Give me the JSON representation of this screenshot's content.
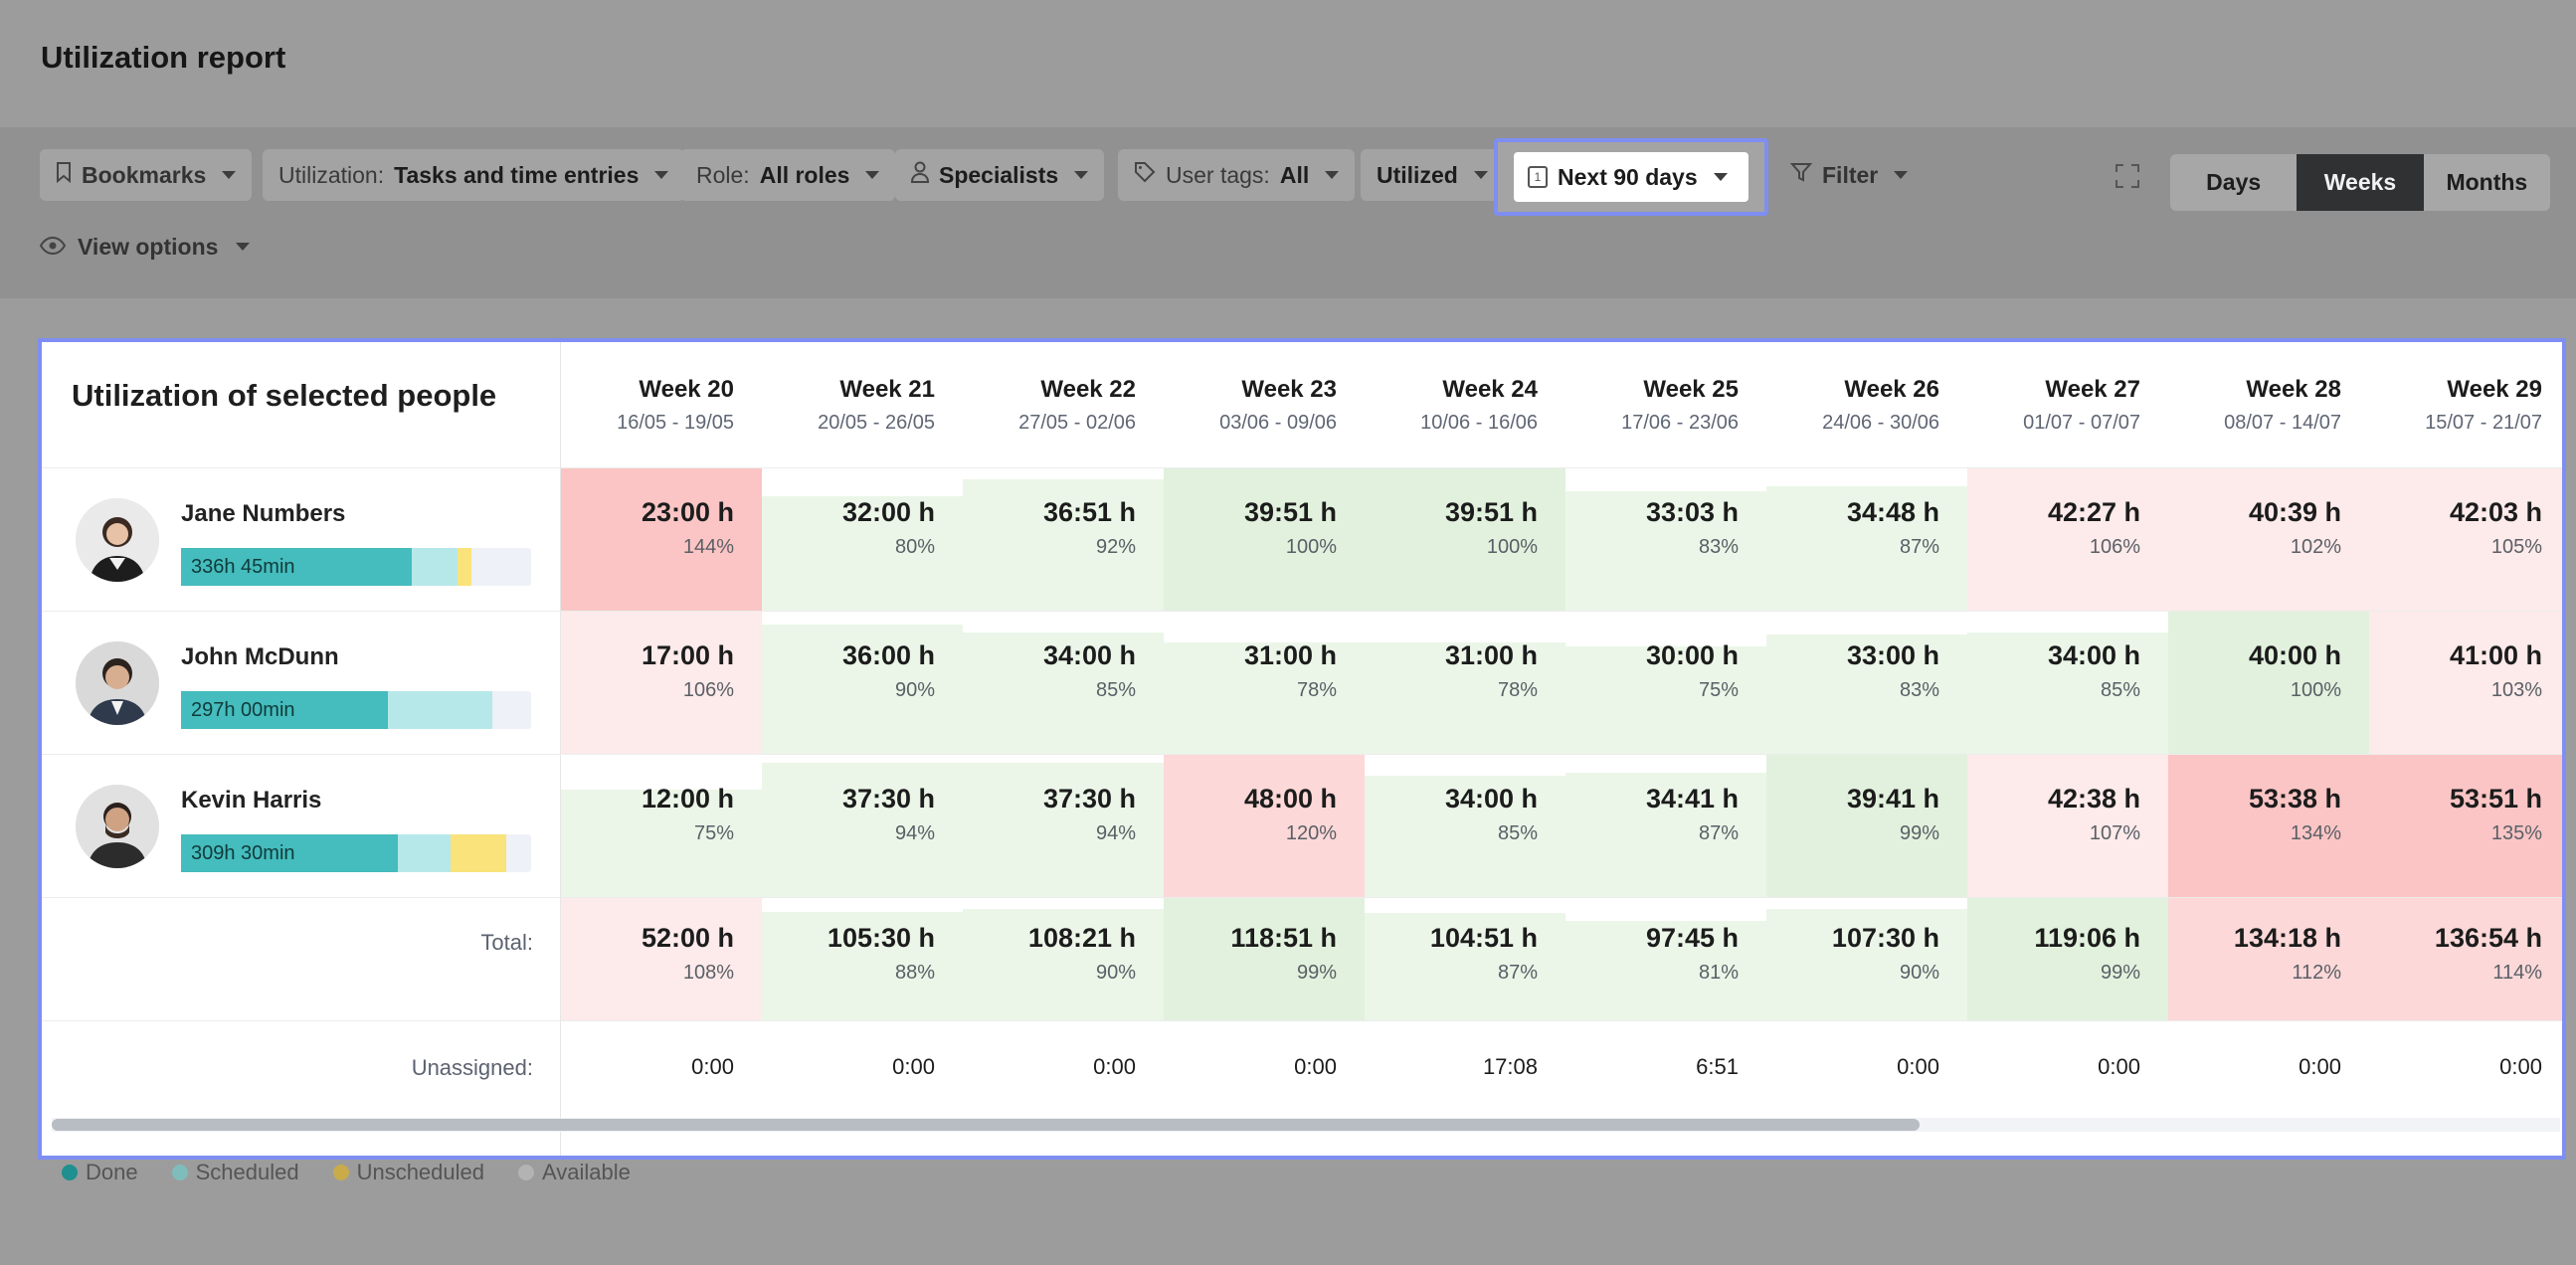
{
  "page": {
    "title": "Utilization report"
  },
  "toolbar": {
    "bookmarks": "Bookmarks",
    "utilization_label": "Utilization:",
    "utilization_value": "Tasks and time entries",
    "role_label": "Role:",
    "role_value": "All roles",
    "specialists": "Specialists",
    "user_tags_label": "User tags:",
    "user_tags_value": "All",
    "utilized": "Utilized",
    "date_range": "Next 90 days",
    "date_icon_num": "1",
    "filter": "Filter",
    "view_options": "View options",
    "periods": [
      "Days",
      "Weeks",
      "Months"
    ],
    "active_period": "Weeks"
  },
  "panel": {
    "title": "Utilization of selected people",
    "total_label": "Total:",
    "unassigned_label": "Unassigned:"
  },
  "weeks": [
    {
      "label": "Week 20",
      "dates": "16/05 - 19/05"
    },
    {
      "label": "Week 21",
      "dates": "20/05 - 26/05"
    },
    {
      "label": "Week 22",
      "dates": "27/05 - 02/06"
    },
    {
      "label": "Week 23",
      "dates": "03/06 - 09/06"
    },
    {
      "label": "Week 24",
      "dates": "10/06 - 16/06"
    },
    {
      "label": "Week 25",
      "dates": "17/06 - 23/06"
    },
    {
      "label": "Week 26",
      "dates": "24/06 - 30/06"
    },
    {
      "label": "Week 27",
      "dates": "01/07 - 07/07"
    },
    {
      "label": "Week 28",
      "dates": "08/07 - 14/07"
    },
    {
      "label": "Week 29",
      "dates": "15/07 - 21/07"
    }
  ],
  "people": [
    {
      "name": "Jane Numbers",
      "total": "336h 45min",
      "bar": {
        "done": 0.66,
        "scheduled": 0.13,
        "unscheduled": 0.04
      },
      "cells": [
        {
          "hours": "23:00 h",
          "pct": "144%",
          "util": 1.44
        },
        {
          "hours": "32:00 h",
          "pct": "80%",
          "util": 0.8
        },
        {
          "hours": "36:51 h",
          "pct": "92%",
          "util": 0.92
        },
        {
          "hours": "39:51 h",
          "pct": "100%",
          "util": 1.0
        },
        {
          "hours": "39:51 h",
          "pct": "100%",
          "util": 1.0
        },
        {
          "hours": "33:03 h",
          "pct": "83%",
          "util": 0.83
        },
        {
          "hours": "34:48 h",
          "pct": "87%",
          "util": 0.87
        },
        {
          "hours": "42:27 h",
          "pct": "106%",
          "util": 1.06
        },
        {
          "hours": "40:39 h",
          "pct": "102%",
          "util": 1.02
        },
        {
          "hours": "42:03 h",
          "pct": "105%",
          "util": 1.05
        }
      ]
    },
    {
      "name": "John McDunn",
      "total": "297h 00min",
      "bar": {
        "done": 0.59,
        "scheduled": 0.3,
        "unscheduled": 0
      },
      "cells": [
        {
          "hours": "17:00 h",
          "pct": "106%",
          "util": 1.06
        },
        {
          "hours": "36:00 h",
          "pct": "90%",
          "util": 0.9
        },
        {
          "hours": "34:00 h",
          "pct": "85%",
          "util": 0.85
        },
        {
          "hours": "31:00 h",
          "pct": "78%",
          "util": 0.78
        },
        {
          "hours": "31:00 h",
          "pct": "78%",
          "util": 0.78
        },
        {
          "hours": "30:00 h",
          "pct": "75%",
          "util": 0.75
        },
        {
          "hours": "33:00 h",
          "pct": "83%",
          "util": 0.83
        },
        {
          "hours": "34:00 h",
          "pct": "85%",
          "util": 0.85
        },
        {
          "hours": "40:00 h",
          "pct": "100%",
          "util": 1.0
        },
        {
          "hours": "41:00 h",
          "pct": "103%",
          "util": 1.03
        }
      ]
    },
    {
      "name": "Kevin Harris",
      "total": "309h 30min",
      "bar": {
        "done": 0.62,
        "scheduled": 0.15,
        "unscheduled": 0.16
      },
      "cells": [
        {
          "hours": "12:00 h",
          "pct": "75%",
          "util": 0.75
        },
        {
          "hours": "37:30 h",
          "pct": "94%",
          "util": 0.94
        },
        {
          "hours": "37:30 h",
          "pct": "94%",
          "util": 0.94
        },
        {
          "hours": "48:00 h",
          "pct": "120%",
          "util": 1.2
        },
        {
          "hours": "34:00 h",
          "pct": "85%",
          "util": 0.85
        },
        {
          "hours": "34:41 h",
          "pct": "87%",
          "util": 0.87
        },
        {
          "hours": "39:41 h",
          "pct": "99%",
          "util": 0.99
        },
        {
          "hours": "42:38 h",
          "pct": "107%",
          "util": 1.07
        },
        {
          "hours": "53:38 h",
          "pct": "134%",
          "util": 1.34
        },
        {
          "hours": "53:51 h",
          "pct": "135%",
          "util": 1.35
        }
      ]
    }
  ],
  "totals": [
    {
      "hours": "52:00 h",
      "pct": "108%",
      "util": 1.08
    },
    {
      "hours": "105:30 h",
      "pct": "88%",
      "util": 0.88
    },
    {
      "hours": "108:21 h",
      "pct": "90%",
      "util": 0.9
    },
    {
      "hours": "118:51 h",
      "pct": "99%",
      "util": 0.99
    },
    {
      "hours": "104:51 h",
      "pct": "87%",
      "util": 0.87
    },
    {
      "hours": "97:45 h",
      "pct": "81%",
      "util": 0.81
    },
    {
      "hours": "107:30 h",
      "pct": "90%",
      "util": 0.9
    },
    {
      "hours": "119:06 h",
      "pct": "99%",
      "util": 0.99
    },
    {
      "hours": "134:18 h",
      "pct": "112%",
      "util": 1.12
    },
    {
      "hours": "136:54 h",
      "pct": "114%",
      "util": 1.14
    }
  ],
  "unassigned": [
    "0:00",
    "0:00",
    "0:00",
    "0:00",
    "17:08",
    "6:51",
    "0:00",
    "0:00",
    "0:00",
    "0:00"
  ],
  "legend": [
    {
      "label": "Done",
      "color": "#1f8f8f"
    },
    {
      "label": "Scheduled",
      "color": "#7fbdbd"
    },
    {
      "label": "Unscheduled",
      "color": "#c9ab4a"
    },
    {
      "label": "Available",
      "color": "#b3b3b3"
    }
  ],
  "colors": {
    "accent_border": "#7e8ef2",
    "over_strong": "#fbc5c5",
    "over_mid": "#fcd8d8",
    "over_light": "#fdeaea",
    "green_strong": "#e1f1dd",
    "green_light": "#ebf6e8",
    "done": "#45bcbd",
    "scheduled": "#b7e8e9",
    "unscheduled": "#f9e37a"
  }
}
